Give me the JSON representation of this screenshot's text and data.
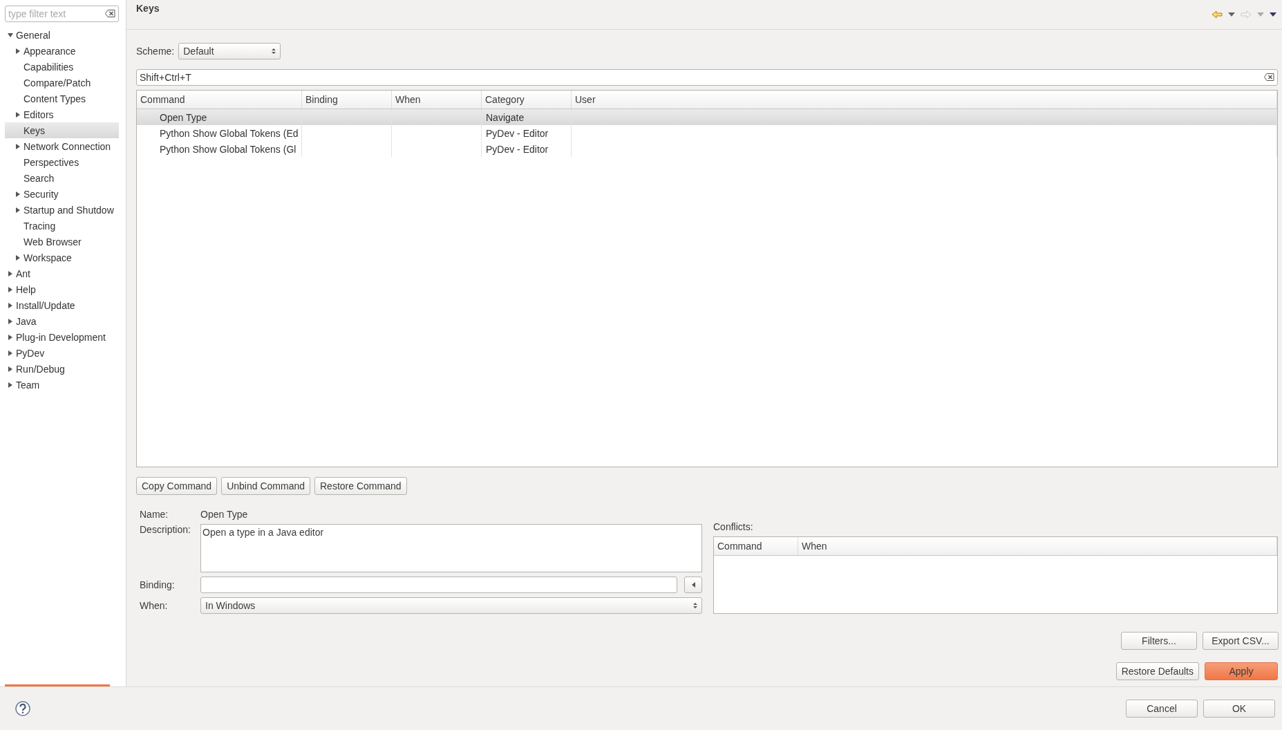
{
  "filter": {
    "placeholder": "type filter text"
  },
  "tree": [
    {
      "label": "General",
      "expandable": true,
      "expanded": true,
      "selected": false,
      "children": [
        {
          "label": "Appearance",
          "expandable": true,
          "expanded": false,
          "selected": false
        },
        {
          "label": "Capabilities",
          "expandable": false,
          "selected": false
        },
        {
          "label": "Compare/Patch",
          "expandable": false,
          "selected": false
        },
        {
          "label": "Content Types",
          "expandable": false,
          "selected": false
        },
        {
          "label": "Editors",
          "expandable": true,
          "expanded": false,
          "selected": false
        },
        {
          "label": "Keys",
          "expandable": false,
          "selected": true
        },
        {
          "label": "Network Connection",
          "expandable": true,
          "expanded": false,
          "selected": false
        },
        {
          "label": "Perspectives",
          "expandable": false,
          "selected": false
        },
        {
          "label": "Search",
          "expandable": false,
          "selected": false
        },
        {
          "label": "Security",
          "expandable": true,
          "expanded": false,
          "selected": false
        },
        {
          "label": "Startup and Shutdow",
          "expandable": true,
          "expanded": false,
          "selected": false
        },
        {
          "label": "Tracing",
          "expandable": false,
          "selected": false
        },
        {
          "label": "Web Browser",
          "expandable": false,
          "selected": false
        },
        {
          "label": "Workspace",
          "expandable": true,
          "expanded": false,
          "selected": false
        }
      ]
    },
    {
      "label": "Ant",
      "expandable": true,
      "expanded": false,
      "selected": false
    },
    {
      "label": "Help",
      "expandable": true,
      "expanded": false,
      "selected": false
    },
    {
      "label": "Install/Update",
      "expandable": true,
      "expanded": false,
      "selected": false
    },
    {
      "label": "Java",
      "expandable": true,
      "expanded": false,
      "selected": false
    },
    {
      "label": "Plug-in Development",
      "expandable": true,
      "expanded": false,
      "selected": false
    },
    {
      "label": "PyDev",
      "expandable": true,
      "expanded": false,
      "selected": false
    },
    {
      "label": "Run/Debug",
      "expandable": true,
      "expanded": false,
      "selected": false
    },
    {
      "label": "Team",
      "expandable": true,
      "expanded": false,
      "selected": false
    }
  ],
  "page": {
    "title": "Keys",
    "back": {
      "disabled": false
    },
    "forward": {
      "disabled": true
    }
  },
  "scheme": {
    "label": "Scheme:",
    "value": "Default"
  },
  "search": {
    "value": "Shift+Ctrl+T"
  },
  "table": {
    "columns": [
      "Command",
      "Binding",
      "When",
      "Category",
      "User"
    ],
    "rows": [
      {
        "cells": [
          "Open Type",
          "",
          "",
          "Navigate",
          ""
        ],
        "selected": true
      },
      {
        "cells": [
          "Python Show Global Tokens (Ed",
          "",
          "",
          "PyDev - Editor",
          ""
        ],
        "selected": false
      },
      {
        "cells": [
          "Python Show Global Tokens (Gl",
          "",
          "",
          "PyDev - Editor",
          ""
        ],
        "selected": false
      }
    ]
  },
  "command_buttons": [
    "Copy Command",
    "Unbind Command",
    "Restore Command"
  ],
  "details": {
    "name_label": "Name:",
    "name": "Open Type",
    "description_label": "Description:",
    "description": "Open a type in a Java editor",
    "binding_label": "Binding:",
    "when_label": "When:",
    "when": "In Windows"
  },
  "conflicts": {
    "label": "Conflicts:",
    "columns": [
      "Command",
      "When"
    ]
  },
  "extra_buttons": [
    "Filters...",
    "Export CSV..."
  ],
  "page_buttons": [
    {
      "label": "Restore Defaults",
      "default": false
    },
    {
      "label": "Apply",
      "default": true
    }
  ],
  "dialog_buttons": [
    {
      "label": "Cancel",
      "default": false
    },
    {
      "label": "OK",
      "default": false
    }
  ]
}
